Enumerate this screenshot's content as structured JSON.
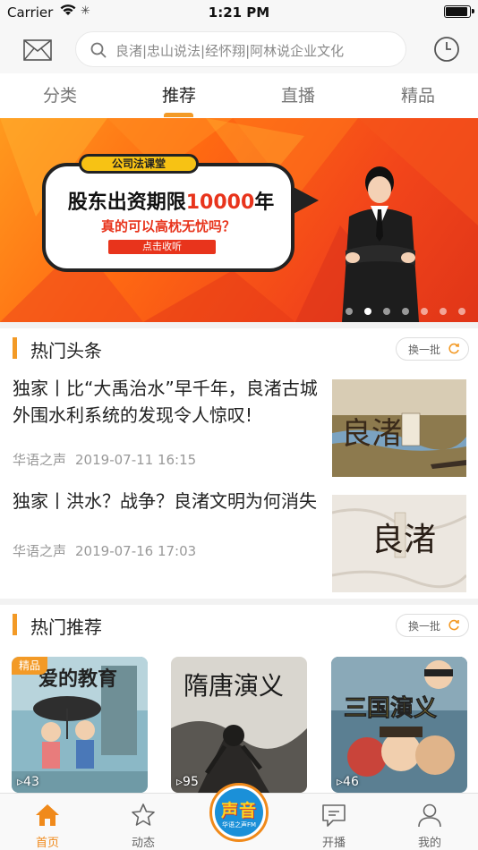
{
  "status_bar": {
    "carrier": "Carrier",
    "time": "1:21 PM"
  },
  "header": {
    "search_placeholder": "良渚|忠山说法|经怀翔|阿林说企业文化"
  },
  "tabs": [
    {
      "label": "分类",
      "active": false
    },
    {
      "label": "推荐",
      "active": true
    },
    {
      "label": "直播",
      "active": false
    },
    {
      "label": "精品",
      "active": false
    }
  ],
  "banner": {
    "tag": "公司法课堂",
    "title_prefix": "股东出资期限",
    "title_number": "10000",
    "title_suffix": "年",
    "subtitle": "真的可以高枕无忧吗？",
    "button": "点击收听",
    "slide_count": 7,
    "active_slide": 2
  },
  "hot_news": {
    "title": "热门头条",
    "refresh": "换一批",
    "items": [
      {
        "title": "独家丨比“大禹治水”早千年，良渚古城外围水利系统的发现令人惊叹!",
        "source": "华语之声",
        "time": "2019-07-11 16:15",
        "thumb_text": "良渚"
      },
      {
        "title": "独家丨洪水？战争？良渚文明为何消失",
        "source": "华语之声",
        "time": "2019-07-16 17:03",
        "thumb_text": "良渚"
      }
    ]
  },
  "hot_rec": {
    "title": "热门推荐",
    "refresh": "换一批",
    "cards": [
      {
        "title": "爱的教育",
        "tag": "精品",
        "count": "43"
      },
      {
        "title": "隋唐演义",
        "tag": "",
        "count": "95"
      },
      {
        "title": "三国演义",
        "tag": "",
        "count": "46"
      }
    ]
  },
  "bottom_nav": {
    "items": [
      {
        "label": "首页",
        "active": true
      },
      {
        "label": "动态",
        "active": false
      },
      {
        "label": "开播",
        "active": false
      },
      {
        "label": "我的",
        "active": false
      }
    ],
    "center": {
      "label": "声音",
      "sub": "华语之声FM"
    }
  },
  "colors": {
    "accent": "#f39a26",
    "banner_red": "#e8341c",
    "center_blue": "#1b90d8"
  }
}
